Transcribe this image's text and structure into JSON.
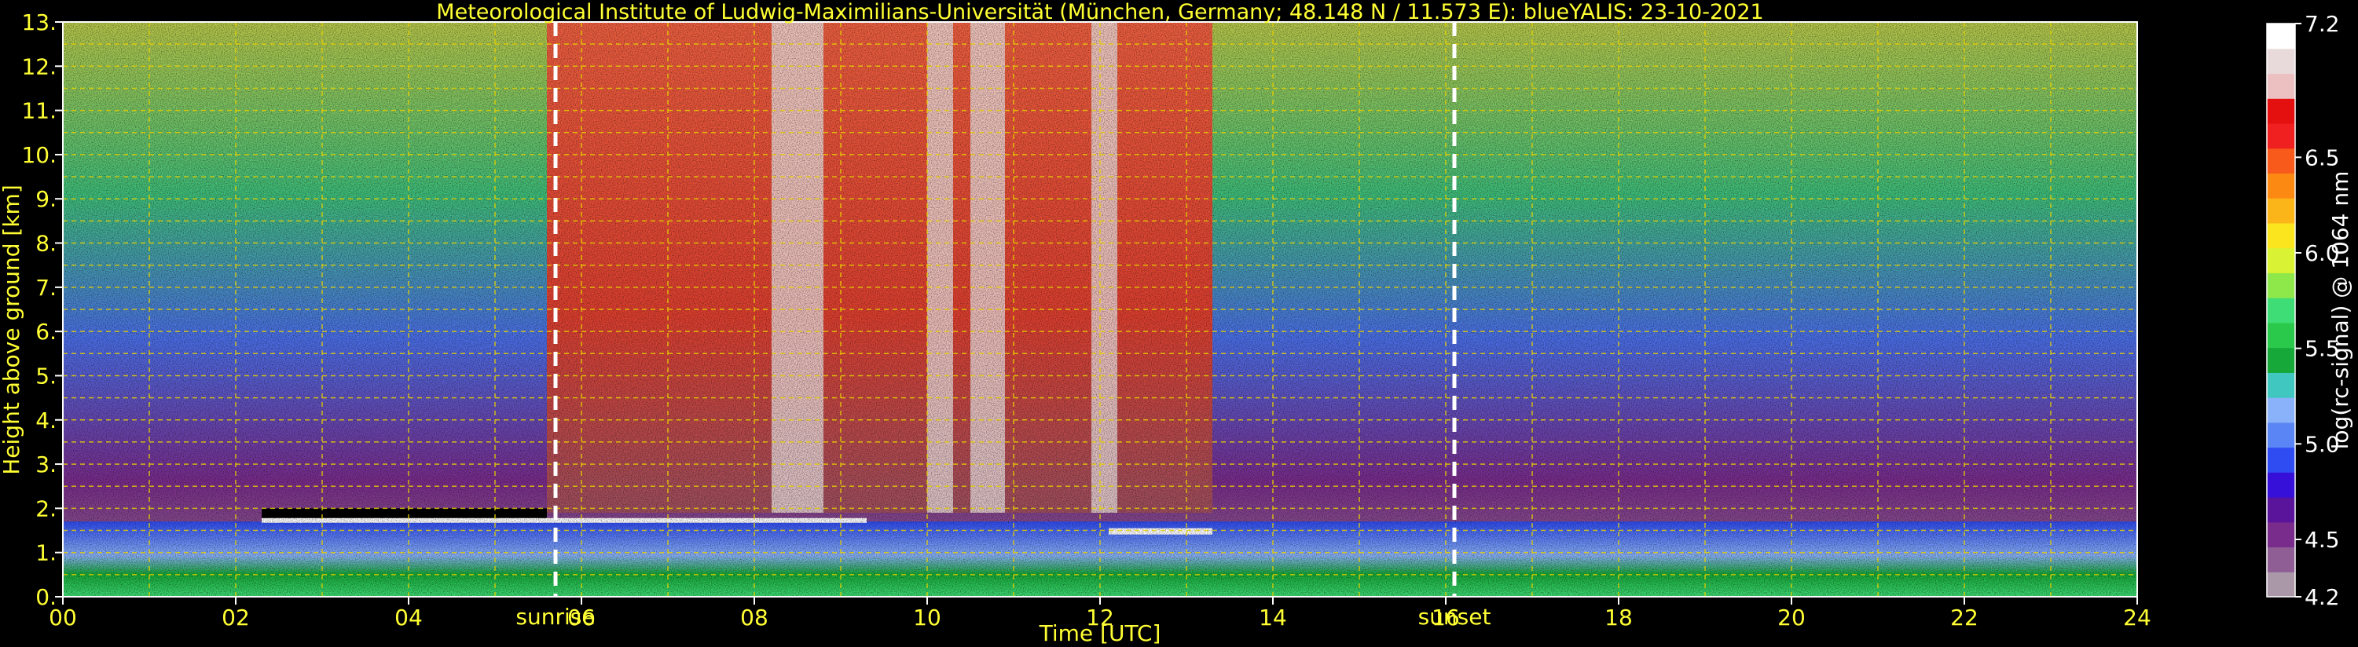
{
  "chart_data": {
    "type": "heatmap",
    "title": "Meteorological Institute of Ludwig-Maximilians-Universität (München, Germany; 48.148 N / 11.573 E):    blueYALIS: 23-10-2021",
    "xlabel": "Time [UTC]",
    "ylabel": "Height above ground [km]",
    "xlim": [
      0,
      24
    ],
    "ylim": [
      0,
      13
    ],
    "x_ticks": [
      "00",
      "02",
      "04",
      "06",
      "08",
      "10",
      "12",
      "14",
      "16",
      "18",
      "20",
      "22",
      "24"
    ],
    "y_ticks": [
      "0.",
      "1.",
      "2.",
      "3.",
      "4.",
      "5.",
      "6.",
      "7.",
      "8.",
      "9.",
      "10.",
      "11.",
      "12.",
      "13."
    ],
    "grid": true,
    "colorbar": {
      "label": "log(rc-signal) @ 1064 nm",
      "range": [
        4.2,
        7.2
      ],
      "ticks": [
        "7.2",
        "6.5",
        "6.0",
        "5.5",
        "5.0",
        "4.5",
        "4.2"
      ],
      "tick_values": [
        7.2,
        6.5,
        6.0,
        5.5,
        5.0,
        4.5,
        4.2
      ],
      "colors": [
        "#aa98a9",
        "#8e5e95",
        "#7a2c8c",
        "#5a149c",
        "#3610d8",
        "#2f4cf2",
        "#5a86f5",
        "#8ab2fa",
        "#3fc7c0",
        "#16a838",
        "#2bc94b",
        "#3edd75",
        "#8fe84a",
        "#d9f233",
        "#fbe51f",
        "#fcb518",
        "#fc8a12",
        "#f75a1a",
        "#f02020",
        "#e40f0f",
        "#ecc0c0",
        "#e8dada",
        "#ffffff"
      ]
    },
    "annotations": [
      {
        "label": "sunrise",
        "time": 5.7
      },
      {
        "label": "sunset",
        "time": 16.1
      }
    ]
  }
}
